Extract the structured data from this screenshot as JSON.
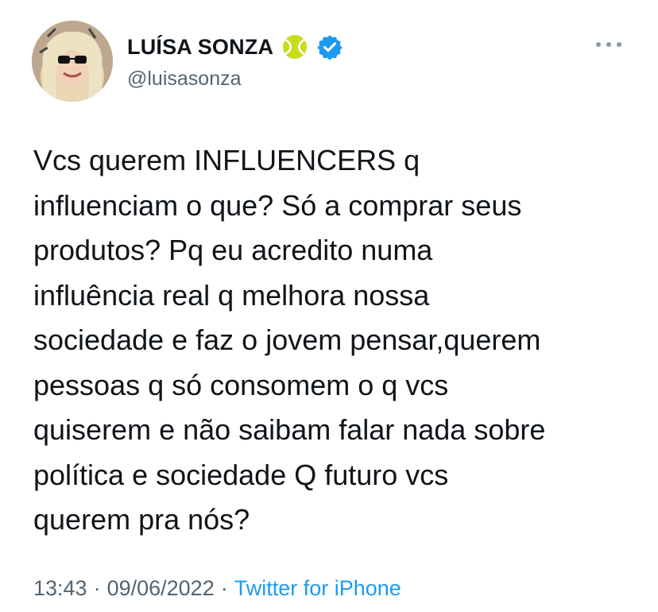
{
  "author": {
    "display_name": "LUÍSA SONZA",
    "handle": "@luisasonza",
    "badge_emoji": "tennis-ball-icon",
    "verified": true
  },
  "tweet": {
    "text": "Vcs querem INFLUENCERS q\ninfluenciam o que? Só a comprar seus\nprodutos? Pq eu acredito numa\ninfluência real q melhora nossa\nsociedade e faz o jovem pensar,querem\npessoas q só consomem o q vcs\nquiserem e não saibam falar nada sobre\npolítica e sociedade Q futuro vcs\nquerem pra nós?",
    "time": "13:43",
    "separator": "·",
    "date": "09/06/2022",
    "source": "Twitter for iPhone"
  },
  "colors": {
    "text": "#0f1419",
    "muted": "#536471",
    "link": "#1d9bf0",
    "verified": "#1d9bf0"
  }
}
